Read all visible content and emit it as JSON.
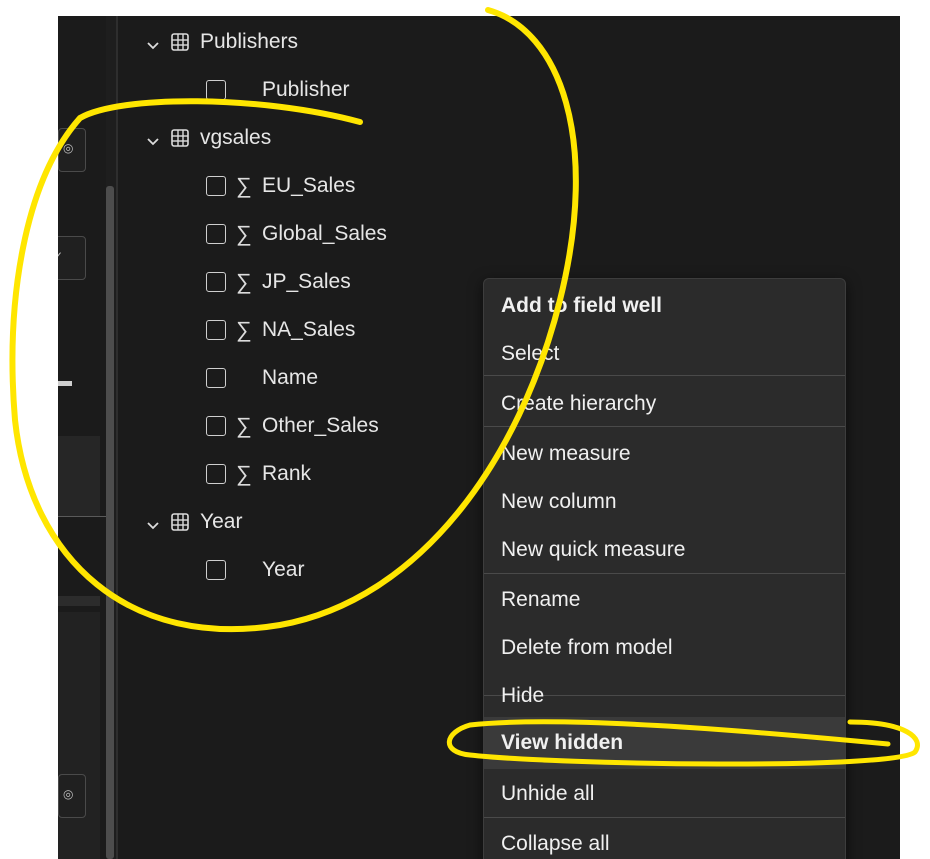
{
  "fields_pane": {
    "groups": [
      {
        "name": "Publishers",
        "fields": [
          {
            "label": "Publisher",
            "sum": false
          }
        ]
      },
      {
        "name": "vgsales",
        "fields": [
          {
            "label": "EU_Sales",
            "sum": true
          },
          {
            "label": "Global_Sales",
            "sum": true
          },
          {
            "label": "JP_Sales",
            "sum": true
          },
          {
            "label": "NA_Sales",
            "sum": true
          },
          {
            "label": "Name",
            "sum": false
          },
          {
            "label": "Other_Sales",
            "sum": true
          },
          {
            "label": "Rank",
            "sum": true
          }
        ]
      },
      {
        "name": "Year",
        "fields": [
          {
            "label": "Year",
            "sum": false
          }
        ]
      }
    ],
    "sum_symbol": "∑"
  },
  "context_menu": {
    "items": [
      "Add to field well",
      "Select",
      "Create hierarchy",
      "New measure",
      "New column",
      "New quick measure",
      "Rename",
      "Delete from model",
      "Hide",
      "View hidden",
      "Unhide all",
      "Collapse all"
    ],
    "highlighted": "View hidden"
  },
  "annotation": {
    "color": "#ffe600"
  },
  "icons": [
    "chevron-down-icon",
    "table-icon",
    "checkbox-icon",
    "sigma-icon"
  ]
}
